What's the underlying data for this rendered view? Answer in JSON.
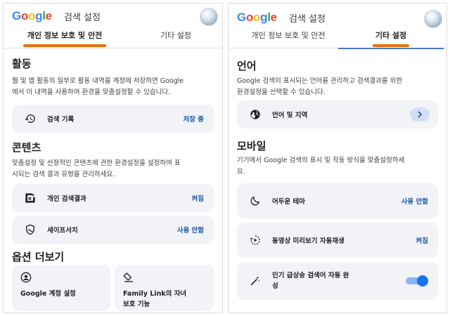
{
  "left": {
    "logo": "Google",
    "app_title": "검색 설정",
    "tabs": [
      {
        "label": "개인 정보 보호 및 안전",
        "active": true
      },
      {
        "label": "기타 설정",
        "active": false
      }
    ],
    "activity": {
      "title": "활동",
      "desc_line1": "웹 및 앱 활동의 일부로 활동 내역을 계정에 저장하면 Google",
      "desc_line2": "에서 이 내역을 사용하여 환경을 맞춤설정할 수 있습니다.",
      "search_history": {
        "icon": "history-icon",
        "label": "검색 기록",
        "value": "저장 중"
      }
    },
    "content": {
      "title": "콘텐츠",
      "desc_line1": "맞춤설정 및 선정적인 콘텐츠에 관한 환경설정을 설정하여 표",
      "desc_line2": "시되는 검색 결과 유형을 관리하세요.",
      "personal_results": {
        "icon": "personal-results-icon",
        "label": "개인 검색결과",
        "value": "켜짐"
      },
      "safesearch": {
        "icon": "safesearch-icon",
        "label": "세이프서치",
        "value": "사용 안함"
      }
    },
    "more": {
      "title": "옵션 더보기",
      "google_account": {
        "icon": "account-circle-icon",
        "label": "Google 계정 설정"
      },
      "family_link": {
        "icon": "family-link-icon",
        "label_line1": "Family Link의 자녀",
        "label_line2": "보호 기능"
      }
    }
  },
  "right": {
    "logo": "Google",
    "app_title": "검색 설정",
    "tabs": [
      {
        "label": "개인 정보 보호 및 안전",
        "active": false
      },
      {
        "label": "기타 설정",
        "active": true
      }
    ],
    "language": {
      "title": "언어",
      "desc_line1": "Google 검색이 표시되는 언어를 관리하고 검색결과를 위한",
      "desc_line2": "환경설정을 선택할 수 있습니다.",
      "language_region": {
        "icon": "globe-icon",
        "label": "언어 및 지역"
      }
    },
    "mobile": {
      "title": "모바일",
      "desc_line1": "기기에서 Google 검색의 표시 및 작동 방식을 맞춤설정하세",
      "desc_line2": "요.",
      "dark_theme": {
        "icon": "moon-icon",
        "label": "어두운 테마",
        "value": "사용 안함"
      },
      "video_autoplay": {
        "icon": "video-autoplay-icon",
        "label": "동영상 미리보기 자동재생",
        "value": "켜짐"
      },
      "trending": {
        "icon": "trending-sparkle-icon",
        "label_line1": "인기 급상승 검색어 자동 완",
        "label_line2": "성",
        "toggle_on": true
      }
    }
  },
  "colors": {
    "accent_orange": "#e8710a",
    "link_blue": "#1a56a7",
    "card_bg": "#f1f3f7",
    "toggle_blue": "#1a73e8"
  }
}
